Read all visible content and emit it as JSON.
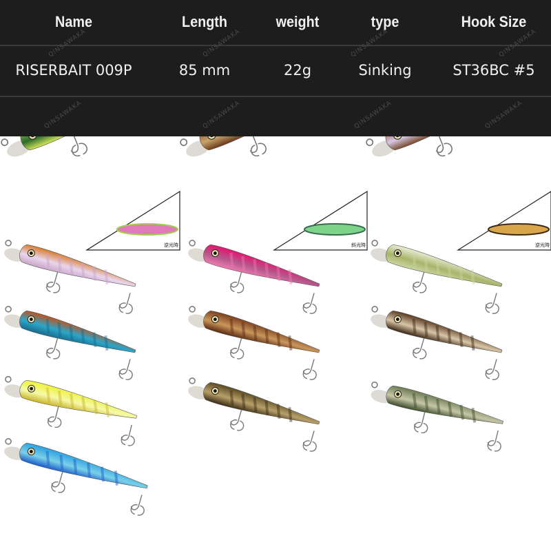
{
  "table": {
    "headers": [
      "Name",
      "Length",
      "weight",
      "type",
      "Hook Size"
    ],
    "row": [
      "RISERBAIT 009P",
      "85 mm",
      "22g",
      "Sinking",
      "ST36BC #5"
    ]
  },
  "watermark": "QINSAWAKA",
  "colors": {
    "table_bg": "#1d1d1d",
    "text": "#f0f0f0",
    "page_bg": "#ffffff"
  },
  "insets": [
    {
      "caption": "逆光時",
      "colors": [
        "#e07ab8",
        "#9fd24a"
      ]
    },
    {
      "caption": "斜光時",
      "colors": [
        "#7dd38a",
        "#3a6a52"
      ]
    },
    {
      "caption": "逆光時",
      "colors": [
        "#d9a64a",
        "#3a2a1a"
      ]
    }
  ],
  "lures": [
    {
      "name": "green-mackerel",
      "style": "large",
      "colors": [
        "#7ac943",
        "#2e6b2a",
        "#d7e85a"
      ]
    },
    {
      "name": "brown-yamame",
      "style": "large",
      "colors": [
        "#8b4a24",
        "#c9a46a",
        "#6b3a1a"
      ]
    },
    {
      "name": "copper-ghost",
      "style": "large",
      "colors": [
        "#a0522d",
        "#d7c9e6",
        "#7a4a2a"
      ]
    },
    {
      "name": "orange-ghost",
      "style": "small",
      "colors": [
        "#d97a2a",
        "#e9d6ec",
        "#c9a4c9"
      ]
    },
    {
      "name": "pink-head",
      "style": "small",
      "colors": [
        "#e5136f",
        "#b35a8c",
        "#f07ab0"
      ]
    },
    {
      "name": "chart-bars",
      "style": "small",
      "colors": [
        "#e8edd6",
        "#a9b46a",
        "#c9d6a0"
      ]
    },
    {
      "name": "copper-tiger",
      "style": "small",
      "colors": [
        "#c0521e",
        "#2aa6c9",
        "#1a6a8a"
      ]
    },
    {
      "name": "brown-shad",
      "style": "small",
      "colors": [
        "#7a3e1e",
        "#c9965a",
        "#5a2a12"
      ]
    },
    {
      "name": "dark-bronze",
      "style": "small",
      "colors": [
        "#5a3a22",
        "#d8c6a6",
        "#3a2414"
      ]
    },
    {
      "name": "chart-yellow",
      "style": "small",
      "colors": [
        "#eef23a",
        "#f5f9a8",
        "#c9b42a"
      ]
    },
    {
      "name": "olive-tiger",
      "style": "small",
      "colors": [
        "#5a4a22",
        "#b8a06a",
        "#3a2a14"
      ]
    },
    {
      "name": "green-shiner",
      "style": "small",
      "colors": [
        "#6a7a52",
        "#c6c6a6",
        "#3a4a2a"
      ]
    },
    {
      "name": "blue-mackerel",
      "style": "small",
      "colors": [
        "#2aa0e0",
        "#7ad0e8",
        "#1a5ac9"
      ]
    }
  ]
}
